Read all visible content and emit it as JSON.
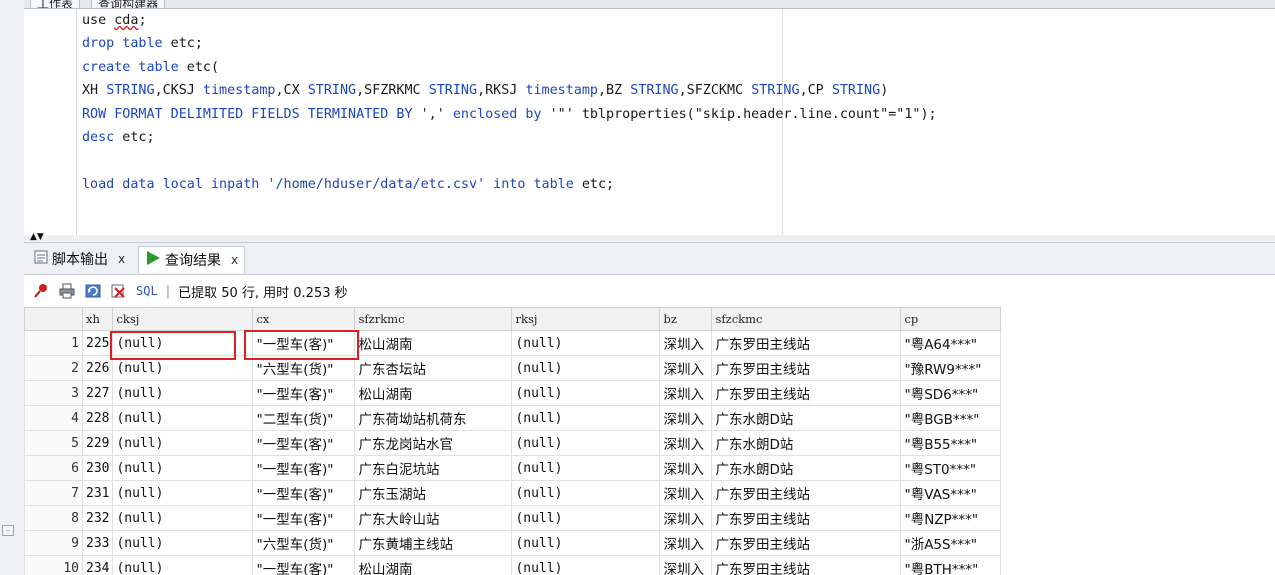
{
  "top_tabs": [
    "工作表",
    "查询构建器"
  ],
  "editor": {
    "lines": [
      [
        [
          "",
          "use "
        ],
        [
          "squig",
          "cda"
        ],
        [
          "",
          ";"
        ]
      ],
      [
        [
          "kw",
          "drop table"
        ],
        [
          "",
          " etc;"
        ]
      ],
      [
        [
          "kw",
          "create table"
        ],
        [
          "",
          " etc("
        ]
      ],
      [
        [
          "",
          "XH "
        ],
        [
          "kw",
          "STRING"
        ],
        [
          "",
          ",CKSJ "
        ],
        [
          "kw",
          "timestamp"
        ],
        [
          "",
          ",CX "
        ],
        [
          "kw",
          "STRING"
        ],
        [
          "",
          ",SFZRKMC "
        ],
        [
          "kw",
          "STRING"
        ],
        [
          "",
          ",RKSJ "
        ],
        [
          "kw",
          "timestamp"
        ],
        [
          "",
          ",BZ "
        ],
        [
          "kw",
          "STRING"
        ],
        [
          "",
          ",SFZCKMC "
        ],
        [
          "kw",
          "STRING"
        ],
        [
          "",
          ",CP "
        ],
        [
          "kw",
          "STRING"
        ],
        [
          "",
          ")"
        ]
      ],
      [
        [
          "kw",
          "ROW FORMAT DELIMITED FIELDS TERMINATED BY"
        ],
        [
          "",
          " ','"
        ],
        [
          "kw",
          " enclosed by"
        ],
        [
          "",
          " '\"' tblproperties(\"skip.header.line.count\"=\"1\");"
        ]
      ],
      [
        [
          "kw",
          "desc"
        ],
        [
          "",
          " etc;"
        ]
      ],
      [
        [
          "",
          ""
        ]
      ],
      [
        [
          "kw",
          "load data local inpath"
        ],
        [
          "str",
          " '/home/hduser/data/etc.csv'"
        ],
        [
          "kw",
          " into table"
        ],
        [
          "",
          " etc;"
        ]
      ]
    ]
  },
  "output_tabs": {
    "script_output": "脚本输出",
    "query_result": "查询结果",
    "close": "x"
  },
  "toolbar": {
    "sql": "SQL",
    "separator": "|",
    "status": "已提取 50 行, 用时 0.253 秒"
  },
  "grid": {
    "columns": [
      "xh",
      "cksj",
      "cx",
      "sfzrkmc",
      "rksj",
      "bz",
      "sfzckmc",
      "cp"
    ],
    "rows": [
      [
        "1",
        "225",
        "(null)",
        "\"一型车(客)\"",
        "松山湖南",
        "(null)",
        "深圳入",
        "广东罗田主线站",
        "\"粤A64***\""
      ],
      [
        "2",
        "226",
        "(null)",
        "\"六型车(货)\"",
        "广东杏坛站",
        "(null)",
        "深圳入",
        "广东罗田主线站",
        "\"豫RW9***\""
      ],
      [
        "3",
        "227",
        "(null)",
        "\"一型车(客)\"",
        "松山湖南",
        "(null)",
        "深圳入",
        "广东罗田主线站",
        "\"粤SD6***\""
      ],
      [
        "4",
        "228",
        "(null)",
        "\"二型车(货)\"",
        "广东荷坳站机荷东",
        "(null)",
        "深圳入",
        "广东水朗D站",
        "\"粤BGB***\""
      ],
      [
        "5",
        "229",
        "(null)",
        "\"一型车(客)\"",
        "广东龙岗站水官",
        "(null)",
        "深圳入",
        "广东水朗D站",
        "\"粤B55***\""
      ],
      [
        "6",
        "230",
        "(null)",
        "\"一型车(客)\"",
        "广东白泥坑站",
        "(null)",
        "深圳入",
        "广东水朗D站",
        "\"粤ST0***\""
      ],
      [
        "7",
        "231",
        "(null)",
        "\"一型车(客)\"",
        "广东玉湖站",
        "(null)",
        "深圳入",
        "广东罗田主线站",
        "\"粤VAS***\""
      ],
      [
        "8",
        "232",
        "(null)",
        "\"一型车(客)\"",
        "广东大岭山站",
        "(null)",
        "深圳入",
        "广东罗田主线站",
        "\"粤NZP***\""
      ],
      [
        "9",
        "233",
        "(null)",
        "\"六型车(货)\"",
        "广东黄埔主线站",
        "(null)",
        "深圳入",
        "广东罗田主线站",
        "\"浙A5S***\""
      ],
      [
        "10",
        "234",
        "(null)",
        "\"一型车(客)\"",
        "松山湖南",
        "(null)",
        "深圳入",
        "广东罗田主线站",
        "\"粤BTH***\""
      ]
    ]
  },
  "colors": {
    "keyword": "#1c46c0",
    "highlight": "#e02020",
    "squiggle": "#e0201f"
  },
  "icons": [
    "pin-icon",
    "print-icon",
    "refresh-icon",
    "export-icon",
    "run-icon",
    "script-output-icon",
    "collapse-arrows-icon"
  ]
}
